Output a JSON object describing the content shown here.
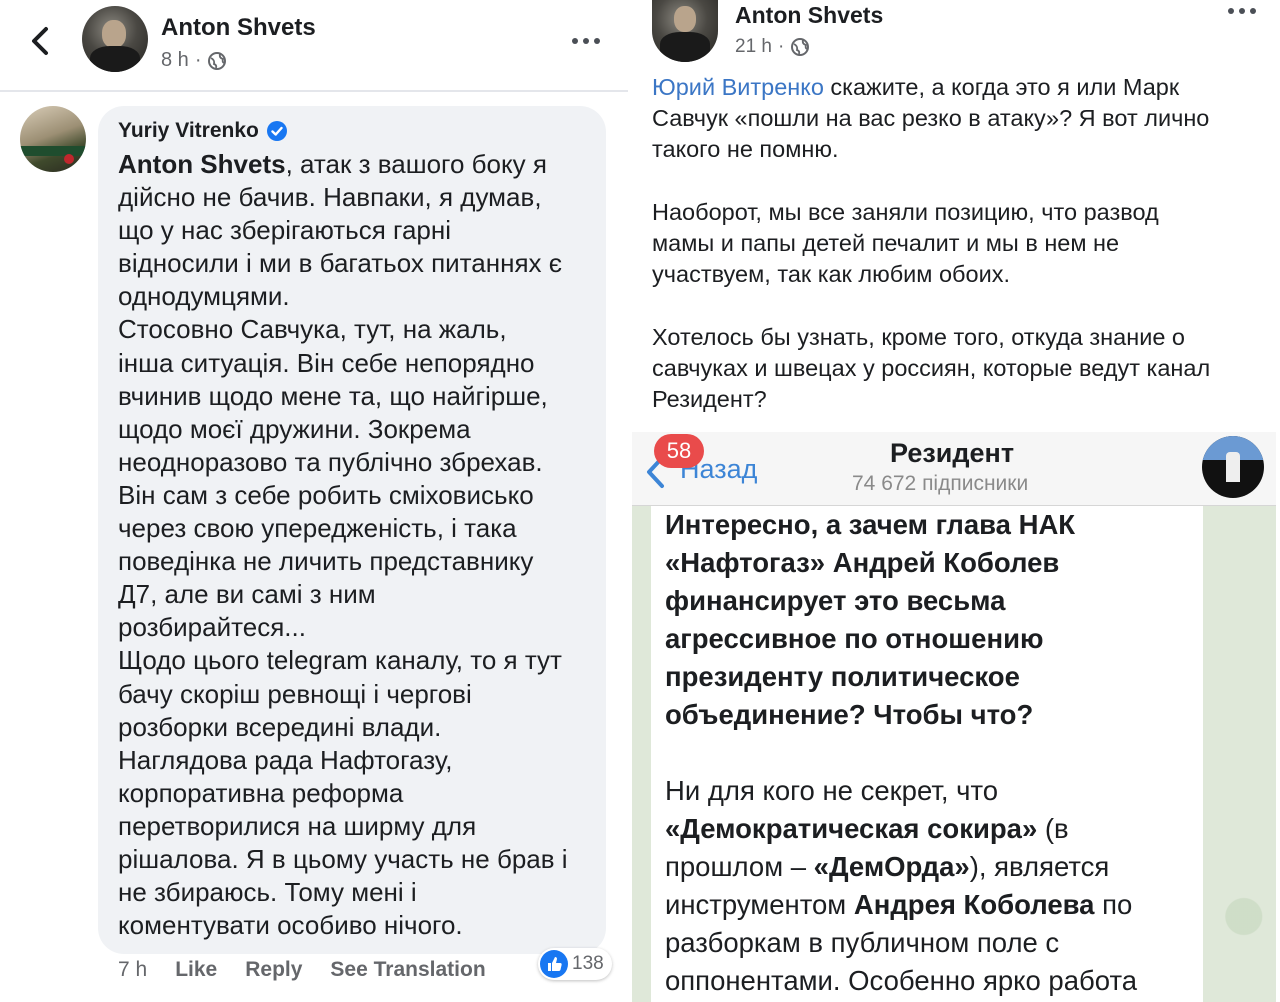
{
  "left": {
    "header": {
      "author": "Anton Shvets",
      "time": "8 h",
      "separator": "·"
    },
    "comment": {
      "author": "Yuriy Vitrenko",
      "verified": true,
      "mention": "Anton Shvets",
      "lines": [
        ",   атак з вашого боку я",
        "дійсно не бачив. Навпаки, я думав,",
        "що у нас зберігаються гарні",
        "відносили і ми в багатьох питаннях є",
        "однодумцями.",
        "Стосовно Савчука, тут, на жаль,",
        "інша ситуація. Він себе непорядно",
        "вчинив щодо мене та, що найгірше,",
        "щодо моєї дружини. Зокрема",
        "неодноразово та публічно збрехав.",
        "Він сам з себе робить сміховисько",
        "через свою упередженість, і така",
        "поведінка не личить представнику",
        "Д7, але ви самі з ним",
        "розбирайтеся...",
        "Щодо цього telegram каналу, то я тут",
        "бачу скоріш ревнощі і чергові",
        "розборки всередині влади.",
        "Наглядова рада Нафтогазу,",
        "корпоративна реформа",
        "перетворилися на ширму для",
        "рішалова. Я в цьому участь не брав і",
        "не збираюсь. Тому мені і",
        "коментувати особиво нічого."
      ],
      "actions": {
        "time": "7 h",
        "like": "Like",
        "reply": "Reply",
        "translate": "See Translation"
      },
      "reaction_count": "138"
    }
  },
  "right": {
    "header": {
      "author": "Anton Shvets",
      "time": "21 h",
      "separator": "·"
    },
    "post": {
      "mention": "Юрий Витренко",
      "first_line_rest": " скажите, а когда это я или Марк",
      "lines_p1": [
        "Савчук «пошли на вас резко в атаку»? Я вот лично",
        "такого не помню."
      ],
      "lines_p2": [
        "Наоборот, мы все заняли позицию, что развод",
        "мамы и папы детей печалит и мы в нем не",
        "участвуем, так как любим обоих."
      ],
      "lines_p3": [
        "Хотелось бы узнать, кроме того, откуда знание о",
        "савчуках и швецах у россиян, которые ведут канал",
        "Резидент?"
      ]
    },
    "telegram": {
      "unread_badge": "58",
      "back_label": "Назад",
      "channel_title": "Резидент",
      "subscribers": "74 672 підписники",
      "bold_lines": [
        "Интересно, а зачем глава НАК",
        "«Нафтогаз» Андрей Коболев",
        "финансирует это весьма",
        "агрессивное по отношению",
        "президенту политическое",
        "объединение? Чтобы что?"
      ],
      "p2_line1": "Ни для кого не секрет, что",
      "p2_line2_bold": "«Демократическая сокира»",
      "p2_line2_rest": " (в",
      "p2_line3_a": "прошлом – ",
      "p2_line3_bold": "«ДемОрда»",
      "p2_line3_rest": "), является",
      "p2_line4_a": "инструментом ",
      "p2_line4_bold": "Андрея Коболева",
      "p2_line4_rest": " по",
      "p2_line5": "разборкам в публичном поле с",
      "p2_line6": "оппонентами. Особенно ярко работа"
    }
  },
  "colors": {
    "link": "#3b76c5",
    "verified": "#1877f2",
    "like": "#1877f2",
    "telegram_badge": "#e94b4b",
    "telegram_back": "#3d85d6"
  },
  "icons": {
    "back": "chevron-left-icon",
    "more": "more-dots-icon",
    "globe": "globe-icon",
    "verified": "verified-badge-icon",
    "like": "like-reaction-icon"
  }
}
